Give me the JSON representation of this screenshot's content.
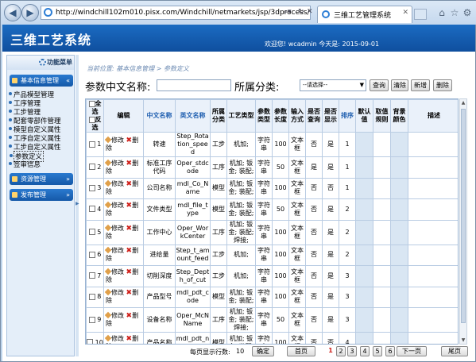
{
  "browser": {
    "url": "http://windchill102m010.pisx.com/Windchill/netmarkets/jsp/3dprocess/index.jsp",
    "tab_title": "三维工艺管理系统"
  },
  "header": {
    "title": "三维工艺系统",
    "welcome": "欢迎您! wcadmin 今天是: 2015-09-01"
  },
  "sidebar": {
    "title": "功能菜单",
    "sections": [
      {
        "label": "基本信息管理",
        "items": [
          "产品模型管理",
          "工序管理",
          "工步管理",
          "配套零部件管理",
          "模型自定义属性",
          "工序自定义属性",
          "工步自定义属性",
          "参数定义",
          "签审信息"
        ]
      },
      {
        "label": "资源管理",
        "items": []
      },
      {
        "label": "发布管理",
        "items": []
      }
    ]
  },
  "breadcrumb": "当前位置: 基本信息管理 > 参数定义",
  "search": {
    "name_label": "参数中文名称:",
    "name_value": "",
    "category_label": "所属分类:",
    "category_value": "--请选择--",
    "buttons": {
      "query": "查询",
      "clear": "清除",
      "add": "新增",
      "delete": "删除"
    }
  },
  "table": {
    "headers": {
      "select": "全选",
      "invert": "反选",
      "edit": "编辑",
      "cn_name": "中文名称",
      "en_name": "英文名称",
      "category": "所属分类",
      "process_type": "工艺类型",
      "param_type": "参数类型",
      "param_length": "参数长度",
      "input_mode": "输入方式",
      "is_query": "是否查询",
      "is_show": "是否显示",
      "order": "排序",
      "default": "默认值",
      "rule": "取值规则",
      "bg_color": "背景颜色",
      "desc": "描述"
    },
    "edit_label": "修改",
    "delete_label": "删除",
    "rows": [
      {
        "no": "1",
        "cn": "转速",
        "en": "Step_Rotation_speed",
        "cat": "工步",
        "proc": "机加;",
        "ptype": "字符串",
        "len": "100",
        "input": "文本框",
        "q": "否",
        "s": "是",
        "ord": "1"
      },
      {
        "no": "2",
        "cn": "标准工序代码",
        "en": "Oper_stdcode",
        "cat": "工序",
        "proc": "机加; 钣金; 装配;",
        "ptype": "字符串",
        "len": "50",
        "input": "文本框",
        "q": "是",
        "s": "是",
        "ord": "1"
      },
      {
        "no": "3",
        "cn": "公司名称",
        "en": "mdl_Co_Name",
        "cat": "模型",
        "proc": "机加; 钣金; 装配;",
        "ptype": "字符串",
        "len": "100",
        "input": "文本框",
        "q": "否",
        "s": "否",
        "ord": "1"
      },
      {
        "no": "4",
        "cn": "文件类型",
        "en": "mdl_file_type",
        "cat": "模型",
        "proc": "机加; 钣金; 装配;",
        "ptype": "字符串",
        "len": "50",
        "input": "文本框",
        "q": "否",
        "s": "是",
        "ord": "2"
      },
      {
        "no": "5",
        "cn": "工作中心",
        "en": "Oper_WorkCenter",
        "cat": "工序",
        "proc": "机加; 钣金; 装配; 焊接;",
        "ptype": "字符串",
        "len": "100",
        "input": "文本框",
        "q": "否",
        "s": "是",
        "ord": "2"
      },
      {
        "no": "6",
        "cn": "进给量",
        "en": "Step_t_amount_feed",
        "cat": "工步",
        "proc": "机加;",
        "ptype": "字符串",
        "len": "100",
        "input": "文本框",
        "q": "否",
        "s": "是",
        "ord": "2"
      },
      {
        "no": "7",
        "cn": "切削深度",
        "en": "Step_Depth_of_cut",
        "cat": "工步",
        "proc": "机加;",
        "ptype": "字符串",
        "len": "100",
        "input": "文本框",
        "q": "否",
        "s": "是",
        "ord": "3"
      },
      {
        "no": "8",
        "cn": "产品型号",
        "en": "mdl_pdt_code",
        "cat": "模型",
        "proc": "机加; 钣金; 装配;",
        "ptype": "字符串",
        "len": "100",
        "input": "文本框",
        "q": "否",
        "s": "是",
        "ord": "3"
      },
      {
        "no": "9",
        "cn": "设备名称",
        "en": "Oper_McNName",
        "cat": "工序",
        "proc": "机加; 钣金; 装配; 焊接;",
        "ptype": "字符串",
        "len": "50",
        "input": "文本框",
        "q": "否",
        "s": "是",
        "ord": "3"
      },
      {
        "no": "10",
        "cn": "产品名称",
        "en": "mdl_pdt_name",
        "cat": "模型",
        "proc": "机加; 钣金; 装配;",
        "ptype": "字符串",
        "len": "100",
        "input": "文本框",
        "q": "否",
        "s": "否",
        "ord": "4"
      }
    ]
  },
  "pager": {
    "page_size_label": "每页显示行数:",
    "page_size": "10",
    "confirm": "确定",
    "first": "首页",
    "pages": [
      "1",
      "2",
      "3",
      "4",
      "5",
      "6"
    ],
    "current": "1",
    "next": "下一页",
    "last": "尾页"
  }
}
